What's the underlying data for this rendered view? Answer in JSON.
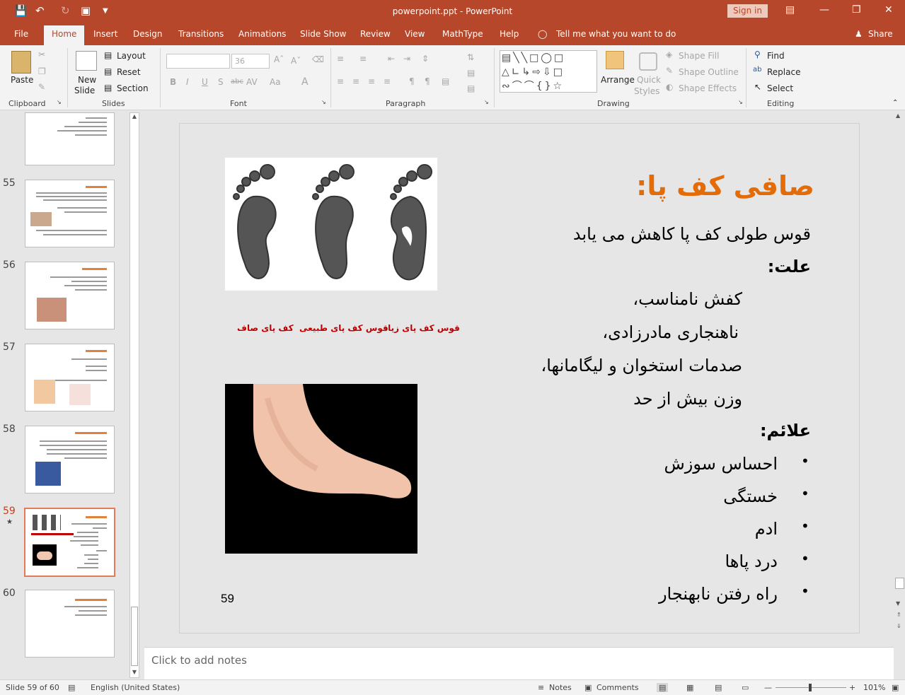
{
  "window": {
    "title": "powerpoint.ppt  -  PowerPoint",
    "sign_in": "Sign in",
    "share": "Share",
    "tell_me": "Tell me what you want to do"
  },
  "tabs": [
    "File",
    "Home",
    "Insert",
    "Design",
    "Transitions",
    "Animations",
    "Slide Show",
    "Review",
    "View",
    "MathType",
    "Help"
  ],
  "ribbon": {
    "clipboard": {
      "label": "Clipboard",
      "paste": "Paste"
    },
    "slides": {
      "label": "Slides",
      "new_slide_1": "New",
      "new_slide_2": "Slide",
      "layout": "Layout",
      "reset": "Reset",
      "section": "Section"
    },
    "font": {
      "label": "Font",
      "size": "36"
    },
    "paragraph": {
      "label": "Paragraph"
    },
    "drawing": {
      "label": "Drawing",
      "arrange": "Arrange",
      "quick_styles_1": "Quick",
      "quick_styles_2": "Styles",
      "shape_fill": "Shape Fill",
      "shape_outline": "Shape Outline",
      "shape_effects": "Shape Effects"
    },
    "editing": {
      "label": "Editing",
      "find": "Find",
      "replace": "Replace",
      "select": "Select"
    }
  },
  "thumbnails": [
    {
      "num": "55"
    },
    {
      "num": "56"
    },
    {
      "num": "57"
    },
    {
      "num": "58"
    },
    {
      "num": "59",
      "selected": true
    },
    {
      "num": "60"
    }
  ],
  "slide": {
    "title": "صافی کف پا:",
    "line1": "قوس طولی کف پا کاهش می یابد",
    "cause_heading": "علت:",
    "causes": [
      "کفش نامناسب،",
      "ناهنجاری مادرزادی،",
      "صدمات استخوان و لیگامانها،",
      "وزن بیش از حد"
    ],
    "signs_heading": "علائم:",
    "signs": [
      "احساس سوزش",
      "خستگی",
      "ادم",
      "درد پاها",
      "راه رفتن نابهنجار"
    ],
    "captions": [
      "قوس کف پای زیاد",
      "قوس کف پای طبیعی",
      "کف پای صاف"
    ],
    "page_number": "59",
    "accent": "#e36c09",
    "caption_color": "#c00000"
  },
  "notes_placeholder": "Click to add notes",
  "status": {
    "slide_info": "Slide 59 of 60",
    "language": "English (United States)",
    "notes": "Notes",
    "comments": "Comments",
    "zoom": "101%"
  }
}
